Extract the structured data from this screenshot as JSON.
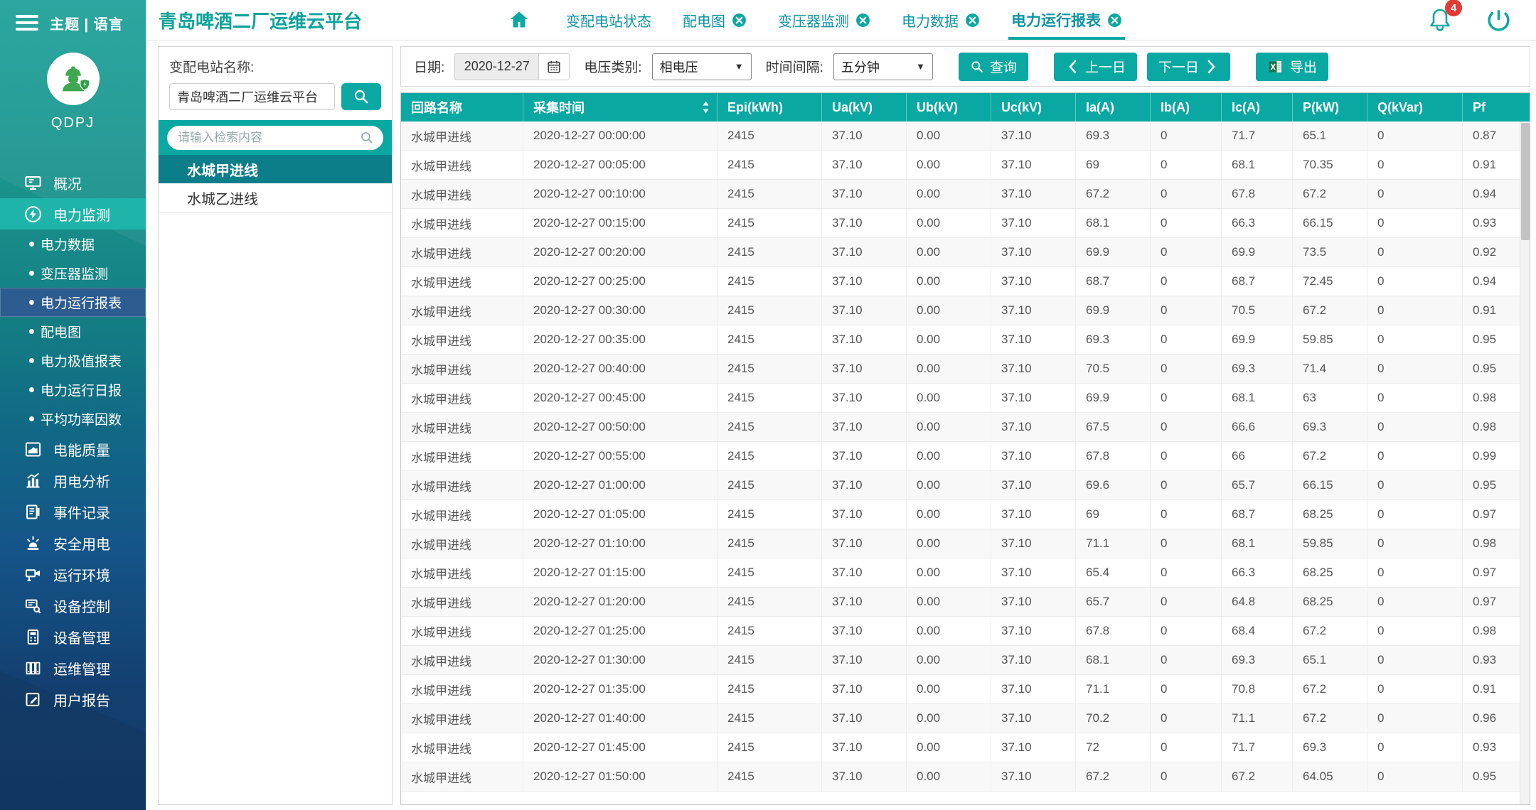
{
  "colors": {
    "accent": "#0aa8a2",
    "badge_red": "#e53935",
    "sidebar_top": "#1fa19a",
    "sidebar_bottom": "#123a66",
    "active_submenu": "#2d5c90",
    "selected_tree_item": "#0c7e8a"
  },
  "sidebar": {
    "top_label": "主题 | 语言",
    "avatar_label": "QDPJ",
    "menu": [
      {
        "key": "overview",
        "label": "概况",
        "type": "item"
      },
      {
        "key": "power-monitoring",
        "label": "电力监测",
        "type": "item",
        "state": "expanded"
      },
      {
        "key": "power-data",
        "label": "电力数据",
        "type": "subitem"
      },
      {
        "key": "transformer-monitoring",
        "label": "变压器监测",
        "type": "subitem"
      },
      {
        "key": "power-operation-report",
        "label": "电力运行报表",
        "type": "subitem",
        "state": "active"
      },
      {
        "key": "distribution-diagram",
        "label": "配电图",
        "type": "subitem"
      },
      {
        "key": "power-extreme-report",
        "label": "电力极值报表",
        "type": "subitem"
      },
      {
        "key": "power-daily-report",
        "label": "电力运行日报",
        "type": "subitem"
      },
      {
        "key": "avg-power-factor",
        "label": "平均功率因数",
        "type": "subitem"
      },
      {
        "key": "power-quality",
        "label": "电能质量",
        "type": "item"
      },
      {
        "key": "usage-analysis",
        "label": "用电分析",
        "type": "item"
      },
      {
        "key": "event-record",
        "label": "事件记录",
        "type": "item"
      },
      {
        "key": "safe-electricity",
        "label": "安全用电",
        "type": "item"
      },
      {
        "key": "operating-environment",
        "label": "运行环境",
        "type": "item"
      },
      {
        "key": "device-control",
        "label": "设备控制",
        "type": "item"
      },
      {
        "key": "device-management",
        "label": "设备管理",
        "type": "item"
      },
      {
        "key": "ops-management",
        "label": "运维管理",
        "type": "item"
      },
      {
        "key": "user-report",
        "label": "用户报告",
        "type": "item"
      }
    ]
  },
  "header": {
    "title": "青岛啤酒二厂运维云平台",
    "notification_count": "4",
    "tabs": [
      {
        "key": "substation-status",
        "label": "变配电站状态",
        "closable": false,
        "active": false
      },
      {
        "key": "distribution-diagram",
        "label": "配电图",
        "closable": true,
        "active": false
      },
      {
        "key": "transformer-monitoring",
        "label": "变压器监测",
        "closable": true,
        "active": false
      },
      {
        "key": "power-data",
        "label": "电力数据",
        "closable": true,
        "active": false
      },
      {
        "key": "power-operation-report",
        "label": "电力运行报表",
        "closable": true,
        "active": true
      }
    ]
  },
  "station_panel": {
    "label": "变配电站名称:",
    "station_input_value": "青岛啤酒二厂运维云平台",
    "search_placeholder": "请输入检索内容",
    "items": [
      {
        "label": "水城甲进线",
        "active": true
      },
      {
        "label": "水城乙进线",
        "active": false
      }
    ]
  },
  "toolbar": {
    "date_label": "日期:",
    "date_value": "2020-12-27",
    "voltage_label": "电压类别:",
    "voltage_value": "相电压",
    "interval_label": "时间间隔:",
    "interval_value": "五分钟",
    "query_label": "查询",
    "prev_label": "上一日",
    "next_label": "下一日",
    "export_label": "导出"
  },
  "table": {
    "columns": [
      "回路名称",
      "采集时间",
      "Epi(kWh)",
      "Ua(kV)",
      "Ub(kV)",
      "Uc(kV)",
      "Ia(A)",
      "Ib(A)",
      "Ic(A)",
      "P(kW)",
      "Q(kVar)",
      "Pf"
    ],
    "rows": [
      [
        "水城甲进线",
        "2020-12-27 00:00:00",
        "2415",
        "37.10",
        "0.00",
        "37.10",
        "69.3",
        "0",
        "71.7",
        "65.1",
        "0",
        "0.87"
      ],
      [
        "水城甲进线",
        "2020-12-27 00:05:00",
        "2415",
        "37.10",
        "0.00",
        "37.10",
        "69",
        "0",
        "68.1",
        "70.35",
        "0",
        "0.91"
      ],
      [
        "水城甲进线",
        "2020-12-27 00:10:00",
        "2415",
        "37.10",
        "0.00",
        "37.10",
        "67.2",
        "0",
        "67.8",
        "67.2",
        "0",
        "0.94"
      ],
      [
        "水城甲进线",
        "2020-12-27 00:15:00",
        "2415",
        "37.10",
        "0.00",
        "37.10",
        "68.1",
        "0",
        "66.3",
        "66.15",
        "0",
        "0.93"
      ],
      [
        "水城甲进线",
        "2020-12-27 00:20:00",
        "2415",
        "37.10",
        "0.00",
        "37.10",
        "69.9",
        "0",
        "69.9",
        "73.5",
        "0",
        "0.92"
      ],
      [
        "水城甲进线",
        "2020-12-27 00:25:00",
        "2415",
        "37.10",
        "0.00",
        "37.10",
        "68.7",
        "0",
        "68.7",
        "72.45",
        "0",
        "0.94"
      ],
      [
        "水城甲进线",
        "2020-12-27 00:30:00",
        "2415",
        "37.10",
        "0.00",
        "37.10",
        "69.9",
        "0",
        "70.5",
        "67.2",
        "0",
        "0.91"
      ],
      [
        "水城甲进线",
        "2020-12-27 00:35:00",
        "2415",
        "37.10",
        "0.00",
        "37.10",
        "69.3",
        "0",
        "69.9",
        "59.85",
        "0",
        "0.95"
      ],
      [
        "水城甲进线",
        "2020-12-27 00:40:00",
        "2415",
        "37.10",
        "0.00",
        "37.10",
        "70.5",
        "0",
        "69.3",
        "71.4",
        "0",
        "0.95"
      ],
      [
        "水城甲进线",
        "2020-12-27 00:45:00",
        "2415",
        "37.10",
        "0.00",
        "37.10",
        "69.9",
        "0",
        "68.1",
        "63",
        "0",
        "0.98"
      ],
      [
        "水城甲进线",
        "2020-12-27 00:50:00",
        "2415",
        "37.10",
        "0.00",
        "37.10",
        "67.5",
        "0",
        "66.6",
        "69.3",
        "0",
        "0.98"
      ],
      [
        "水城甲进线",
        "2020-12-27 00:55:00",
        "2415",
        "37.10",
        "0.00",
        "37.10",
        "67.8",
        "0",
        "66",
        "67.2",
        "0",
        "0.99"
      ],
      [
        "水城甲进线",
        "2020-12-27 01:00:00",
        "2415",
        "37.10",
        "0.00",
        "37.10",
        "69.6",
        "0",
        "65.7",
        "66.15",
        "0",
        "0.95"
      ],
      [
        "水城甲进线",
        "2020-12-27 01:05:00",
        "2415",
        "37.10",
        "0.00",
        "37.10",
        "69",
        "0",
        "68.7",
        "68.25",
        "0",
        "0.97"
      ],
      [
        "水城甲进线",
        "2020-12-27 01:10:00",
        "2415",
        "37.10",
        "0.00",
        "37.10",
        "71.1",
        "0",
        "68.1",
        "59.85",
        "0",
        "0.98"
      ],
      [
        "水城甲进线",
        "2020-12-27 01:15:00",
        "2415",
        "37.10",
        "0.00",
        "37.10",
        "65.4",
        "0",
        "66.3",
        "68.25",
        "0",
        "0.97"
      ],
      [
        "水城甲进线",
        "2020-12-27 01:20:00",
        "2415",
        "37.10",
        "0.00",
        "37.10",
        "65.7",
        "0",
        "64.8",
        "68.25",
        "0",
        "0.97"
      ],
      [
        "水城甲进线",
        "2020-12-27 01:25:00",
        "2415",
        "37.10",
        "0.00",
        "37.10",
        "67.8",
        "0",
        "68.4",
        "67.2",
        "0",
        "0.98"
      ],
      [
        "水城甲进线",
        "2020-12-27 01:30:00",
        "2415",
        "37.10",
        "0.00",
        "37.10",
        "68.1",
        "0",
        "69.3",
        "65.1",
        "0",
        "0.93"
      ],
      [
        "水城甲进线",
        "2020-12-27 01:35:00",
        "2415",
        "37.10",
        "0.00",
        "37.10",
        "71.1",
        "0",
        "70.8",
        "67.2",
        "0",
        "0.91"
      ],
      [
        "水城甲进线",
        "2020-12-27 01:40:00",
        "2415",
        "37.10",
        "0.00",
        "37.10",
        "70.2",
        "0",
        "71.1",
        "67.2",
        "0",
        "0.96"
      ],
      [
        "水城甲进线",
        "2020-12-27 01:45:00",
        "2415",
        "37.10",
        "0.00",
        "37.10",
        "72",
        "0",
        "71.7",
        "69.3",
        "0",
        "0.93"
      ],
      [
        "水城甲进线",
        "2020-12-27 01:50:00",
        "2415",
        "37.10",
        "0.00",
        "37.10",
        "67.2",
        "0",
        "67.2",
        "64.05",
        "0",
        "0.95"
      ]
    ]
  }
}
